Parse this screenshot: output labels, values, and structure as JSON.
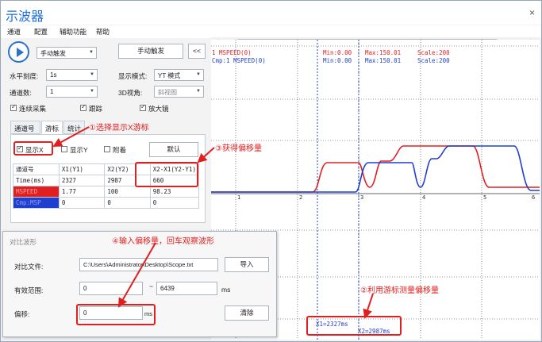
{
  "window": {
    "title": "示波器",
    "close": "×"
  },
  "menu": [
    "通道",
    "配置",
    "辅助功能",
    "帮助"
  ],
  "toolbar": {
    "trigger_mode": "手动触发",
    "manual_trigger_button": "手动触发",
    "collapse": "<<"
  },
  "settings": {
    "h_scale_label": "水平刻度:",
    "h_scale_value": "1s",
    "display_mode_label": "显示模式:",
    "display_mode_value": "YT 模式",
    "channels_label": "通道数:",
    "channels_value": "1",
    "view3d_label": "3D视角:",
    "view3d_value": "斜视图",
    "continuous_label": "连续采集",
    "follow_label": "跟踪",
    "magnifier_label": "放大镜"
  },
  "tabs": [
    "通道号",
    "游标",
    "统计"
  ],
  "cursor": {
    "show_x_label": "显示X",
    "show_y_label": "显示Y",
    "attach_label": "附着",
    "default_button": "默认"
  },
  "table": {
    "headers": [
      "通道号",
      "X1(Y1)",
      "X2(Y2)",
      "X2-X1(Y2-Y1)"
    ],
    "rows": [
      {
        "name": "Time(ms)",
        "x1": "2327",
        "x2": "2987",
        "diff": "660"
      },
      {
        "name": "MSPEED",
        "x1": "1.77",
        "x2": "100",
        "diff": "98.23"
      },
      {
        "name": "Cmp:MSP",
        "x1": "0",
        "x2": "0",
        "diff": "0"
      }
    ]
  },
  "annotations": {
    "a1": "①选择显示X游标",
    "a2": "②利用游标测量偏移量",
    "a3": "③获得偏移量",
    "a4": "④输入偏移量，回车观察波形"
  },
  "dialog": {
    "title": "对比波形",
    "file_label": "对比文件:",
    "file_value": "C:\\Users\\Administrator\\Desktop\\Scope.txt",
    "import_button": "导入",
    "range_label": "有效范围:",
    "range_from": "0",
    "range_sep": "~",
    "range_to": "6439",
    "range_unit": "ms",
    "offset_label": "偏移:",
    "offset_value": "0",
    "offset_unit": "ms",
    "clear_button": "清除"
  },
  "scope": {
    "legend": [
      {
        "text": "1 MSPEED(0)",
        "min": "Min:0.00",
        "max": "Max:150.01",
        "scale": "Scale:200",
        "color": "#e02020"
      },
      {
        "text": "Cmp:1 MSPEED(0)",
        "min": "Min:0.00",
        "max": "Max:150.01",
        "scale": "Scale:200",
        "color": "#1e3fd0"
      }
    ],
    "x_ticks": [
      "1",
      "2",
      "3",
      "4",
      "5",
      "6"
    ],
    "cursor1": "X1=2327ms",
    "cursor2": "X2=2987ms"
  },
  "colors": {
    "red": "#e02020",
    "blue": "#1e3fd0",
    "accent": "#1e6fd9"
  }
}
